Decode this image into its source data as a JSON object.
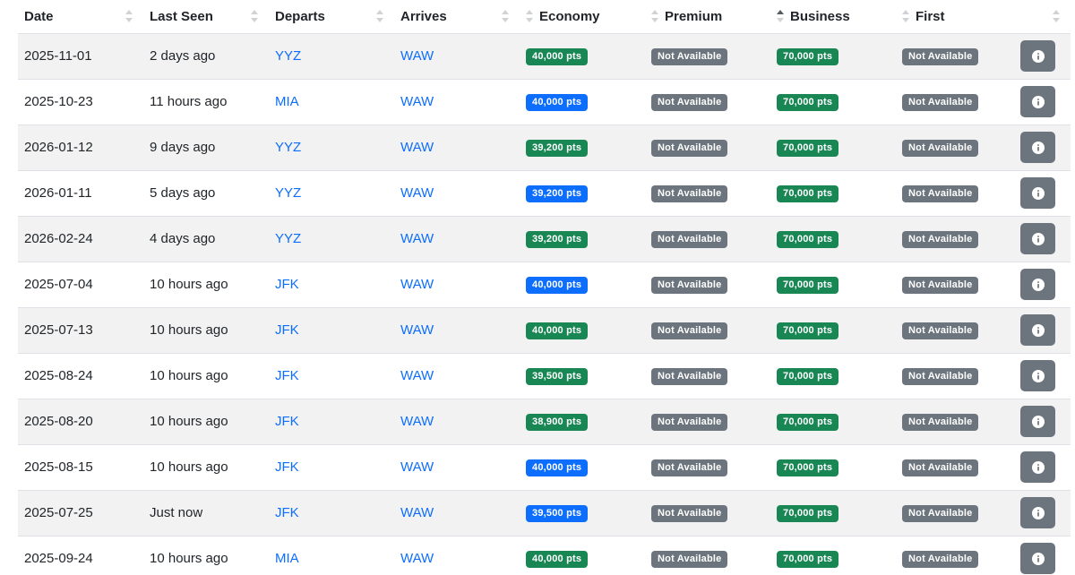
{
  "columns": [
    {
      "label": "Date",
      "sortable": true,
      "sort_side": "right"
    },
    {
      "label": "Last Seen",
      "sortable": true,
      "sort_side": "right"
    },
    {
      "label": "Departs",
      "sortable": true,
      "sort_side": "right"
    },
    {
      "label": "Arrives",
      "sortable": true,
      "sort_side": "right"
    },
    {
      "label": "Economy",
      "sortable": true,
      "sort_side": "left"
    },
    {
      "label": "Premium",
      "sortable": true,
      "sort_side": "left"
    },
    {
      "label": "Business",
      "sortable": true,
      "sort_side": "left",
      "active": "ascending"
    },
    {
      "label": "First",
      "sortable": true,
      "sort_side": "left"
    },
    {
      "label": "",
      "sortable": true,
      "sort_side": "right"
    }
  ],
  "colors": {
    "link": "#0d6efd",
    "badge_green": "#198754",
    "badge_blue": "#0d6efd",
    "badge_gray": "#6c757d",
    "row_stripe": "#f2f2f2"
  },
  "rows": [
    {
      "date": "2025-11-01",
      "last_seen": "2 days ago",
      "departs": "YYZ",
      "arrives": "WAW",
      "economy": {
        "text": "40,000 pts",
        "color": "green"
      },
      "premium": {
        "text": "Not Available",
        "color": "gray"
      },
      "business": {
        "text": "70,000 pts",
        "color": "green"
      },
      "first": {
        "text": "Not Available",
        "color": "gray"
      },
      "action_icon": "info-icon"
    },
    {
      "date": "2025-10-23",
      "last_seen": "11 hours ago",
      "departs": "MIA",
      "arrives": "WAW",
      "economy": {
        "text": "40,000 pts",
        "color": "blue"
      },
      "premium": {
        "text": "Not Available",
        "color": "gray"
      },
      "business": {
        "text": "70,000 pts",
        "color": "green"
      },
      "first": {
        "text": "Not Available",
        "color": "gray"
      },
      "action_icon": "info-icon"
    },
    {
      "date": "2026-01-12",
      "last_seen": "9 days ago",
      "departs": "YYZ",
      "arrives": "WAW",
      "economy": {
        "text": "39,200 pts",
        "color": "green"
      },
      "premium": {
        "text": "Not Available",
        "color": "gray"
      },
      "business": {
        "text": "70,000 pts",
        "color": "green"
      },
      "first": {
        "text": "Not Available",
        "color": "gray"
      },
      "action_icon": "info-icon"
    },
    {
      "date": "2026-01-11",
      "last_seen": "5 days ago",
      "departs": "YYZ",
      "arrives": "WAW",
      "economy": {
        "text": "39,200 pts",
        "color": "blue"
      },
      "premium": {
        "text": "Not Available",
        "color": "gray"
      },
      "business": {
        "text": "70,000 pts",
        "color": "green"
      },
      "first": {
        "text": "Not Available",
        "color": "gray"
      },
      "action_icon": "info-icon"
    },
    {
      "date": "2026-02-24",
      "last_seen": "4 days ago",
      "departs": "YYZ",
      "arrives": "WAW",
      "economy": {
        "text": "39,200 pts",
        "color": "green"
      },
      "premium": {
        "text": "Not Available",
        "color": "gray"
      },
      "business": {
        "text": "70,000 pts",
        "color": "green"
      },
      "first": {
        "text": "Not Available",
        "color": "gray"
      },
      "action_icon": "info-icon"
    },
    {
      "date": "2025-07-04",
      "last_seen": "10 hours ago",
      "departs": "JFK",
      "arrives": "WAW",
      "economy": {
        "text": "40,000 pts",
        "color": "blue"
      },
      "premium": {
        "text": "Not Available",
        "color": "gray"
      },
      "business": {
        "text": "70,000 pts",
        "color": "green"
      },
      "first": {
        "text": "Not Available",
        "color": "gray"
      },
      "action_icon": "info-icon"
    },
    {
      "date": "2025-07-13",
      "last_seen": "10 hours ago",
      "departs": "JFK",
      "arrives": "WAW",
      "economy": {
        "text": "40,000 pts",
        "color": "green"
      },
      "premium": {
        "text": "Not Available",
        "color": "gray"
      },
      "business": {
        "text": "70,000 pts",
        "color": "green"
      },
      "first": {
        "text": "Not Available",
        "color": "gray"
      },
      "action_icon": "info-icon"
    },
    {
      "date": "2025-08-24",
      "last_seen": "10 hours ago",
      "departs": "JFK",
      "arrives": "WAW",
      "economy": {
        "text": "39,500 pts",
        "color": "green"
      },
      "premium": {
        "text": "Not Available",
        "color": "gray"
      },
      "business": {
        "text": "70,000 pts",
        "color": "green"
      },
      "first": {
        "text": "Not Available",
        "color": "gray"
      },
      "action_icon": "info-icon"
    },
    {
      "date": "2025-08-20",
      "last_seen": "10 hours ago",
      "departs": "JFK",
      "arrives": "WAW",
      "economy": {
        "text": "38,900 pts",
        "color": "green"
      },
      "premium": {
        "text": "Not Available",
        "color": "gray"
      },
      "business": {
        "text": "70,000 pts",
        "color": "green"
      },
      "first": {
        "text": "Not Available",
        "color": "gray"
      },
      "action_icon": "info-icon"
    },
    {
      "date": "2025-08-15",
      "last_seen": "10 hours ago",
      "departs": "JFK",
      "arrives": "WAW",
      "economy": {
        "text": "40,000 pts",
        "color": "blue"
      },
      "premium": {
        "text": "Not Available",
        "color": "gray"
      },
      "business": {
        "text": "70,000 pts",
        "color": "green"
      },
      "first": {
        "text": "Not Available",
        "color": "gray"
      },
      "action_icon": "info-icon"
    },
    {
      "date": "2025-07-25",
      "last_seen": "Just now",
      "departs": "JFK",
      "arrives": "WAW",
      "economy": {
        "text": "39,500 pts",
        "color": "blue"
      },
      "premium": {
        "text": "Not Available",
        "color": "gray"
      },
      "business": {
        "text": "70,000 pts",
        "color": "green"
      },
      "first": {
        "text": "Not Available",
        "color": "gray"
      },
      "action_icon": "info-icon"
    },
    {
      "date": "2025-09-24",
      "last_seen": "10 hours ago",
      "departs": "MIA",
      "arrives": "WAW",
      "economy": {
        "text": "40,000 pts",
        "color": "green"
      },
      "premium": {
        "text": "Not Available",
        "color": "gray"
      },
      "business": {
        "text": "70,000 pts",
        "color": "green"
      },
      "first": {
        "text": "Not Available",
        "color": "gray"
      },
      "action_icon": "info-icon"
    }
  ]
}
